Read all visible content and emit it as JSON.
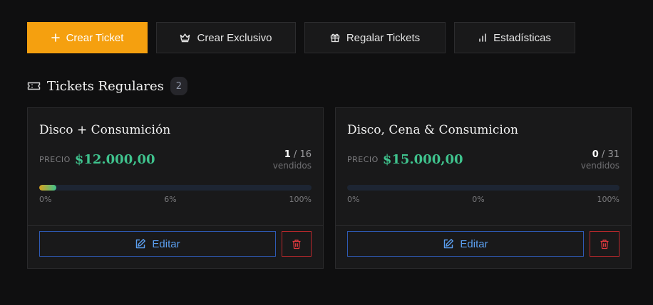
{
  "toolbar": {
    "create_ticket": "Crear Ticket",
    "create_exclusive": "Crear Exclusivo",
    "gift_tickets": "Regalar Tickets",
    "statistics": "Estadísticas"
  },
  "section": {
    "title": "Tickets Regulares",
    "count": "2"
  },
  "tickets": [
    {
      "name": "Disco + Consumición",
      "price_label": "PRECIO",
      "price": "$12.000,00",
      "sold": "1",
      "separator": " / ",
      "total": "16",
      "sold_label": "vendidos",
      "progress_min": "0%",
      "progress_value": "6%",
      "progress_max": "100%",
      "progress_fraction": 0.0625,
      "edit_label": "Editar"
    },
    {
      "name": "Disco, Cena & Consumicion",
      "price_label": "PRECIO",
      "price": "$15.000,00",
      "sold": "0",
      "separator": " / ",
      "total": "31",
      "sold_label": "vendidos",
      "progress_min": "0%",
      "progress_value": "0%",
      "progress_max": "100%",
      "progress_fraction": 0,
      "edit_label": "Editar"
    }
  ],
  "colors": {
    "accent": "#f5a00f",
    "price": "#3fc28d",
    "edit": "#5b9ff0",
    "delete": "#b8282c"
  },
  "icons": {
    "create": "plus-icon",
    "exclusive": "crown-icon",
    "gift": "gift-icon",
    "statistics": "bar-chart-icon",
    "section": "ticket-icon",
    "edit": "edit-icon",
    "delete": "trash-icon"
  }
}
